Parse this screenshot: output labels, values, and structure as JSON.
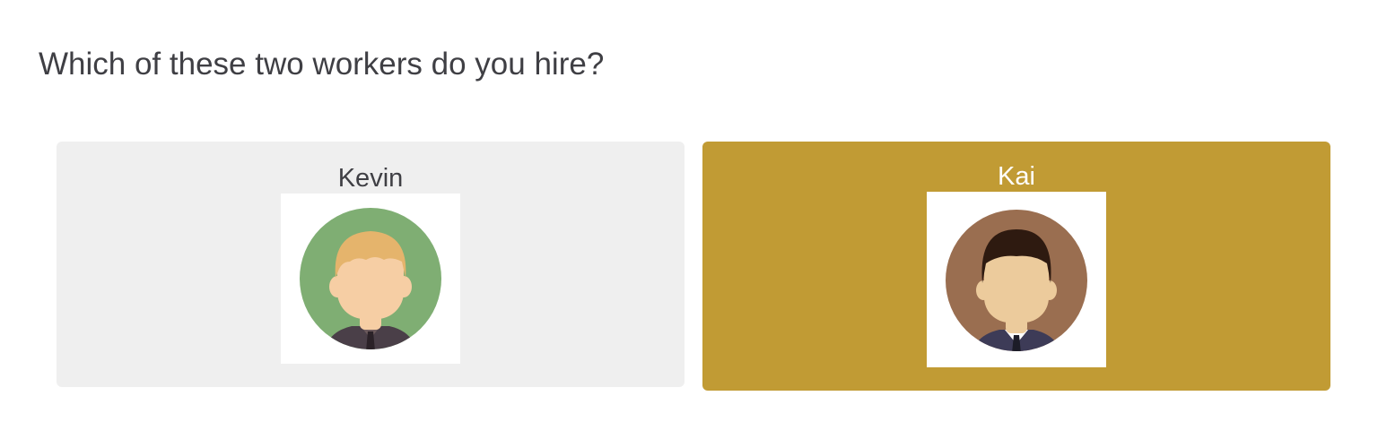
{
  "question": "Which of these two workers do you hire?",
  "workers": [
    {
      "name": "Kevin",
      "selected": false,
      "card_color": "#efefef",
      "avatar": {
        "icon": "worker-avatar-icon",
        "background_color": "#7fae73",
        "hair_color": "#e5b46c",
        "skin_color": "#f6cea4",
        "suit_color": "#4a3f48"
      }
    },
    {
      "name": "Kai",
      "selected": true,
      "card_color": "#c19b34",
      "avatar": {
        "icon": "worker-avatar-icon",
        "background_color": "#9a6e50",
        "hair_color": "#2e1a10",
        "skin_color": "#eccb9c",
        "suit_color": "#3d3b57"
      }
    }
  ]
}
